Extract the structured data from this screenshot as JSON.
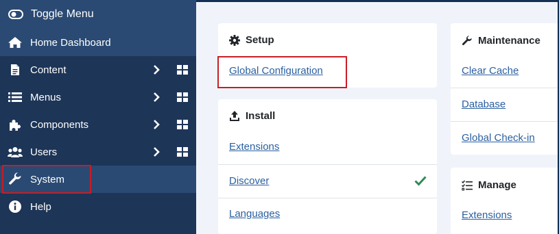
{
  "sidebar": {
    "toggle_label": "Toggle Menu",
    "home_label": "Home Dashboard",
    "items": [
      {
        "label": "Content",
        "icon": "file-icon",
        "has_submenu": true
      },
      {
        "label": "Menus",
        "icon": "list-icon",
        "has_submenu": true
      },
      {
        "label": "Components",
        "icon": "puzzle-icon",
        "has_submenu": true
      },
      {
        "label": "Users",
        "icon": "users-icon",
        "has_submenu": true
      },
      {
        "label": "System",
        "icon": "wrench-icon",
        "has_submenu": false,
        "active": true
      },
      {
        "label": "Help",
        "icon": "info-icon",
        "has_submenu": false
      }
    ]
  },
  "setup": {
    "title": "Setup",
    "links": [
      "Global Configuration"
    ]
  },
  "install": {
    "title": "Install",
    "links": [
      "Extensions",
      "Discover",
      "Languages"
    ]
  },
  "maintenance": {
    "title": "Maintenance",
    "links": [
      "Clear Cache",
      "Database",
      "Global Check-in"
    ]
  },
  "manage": {
    "title": "Manage",
    "links": [
      "Extensions"
    ]
  },
  "colors": {
    "sidebar_bg": "#1d3557",
    "sidebar_active": "#2a4a73",
    "link": "#2a5fa0",
    "highlight": "#c81d25",
    "check": "#2e8a57"
  }
}
